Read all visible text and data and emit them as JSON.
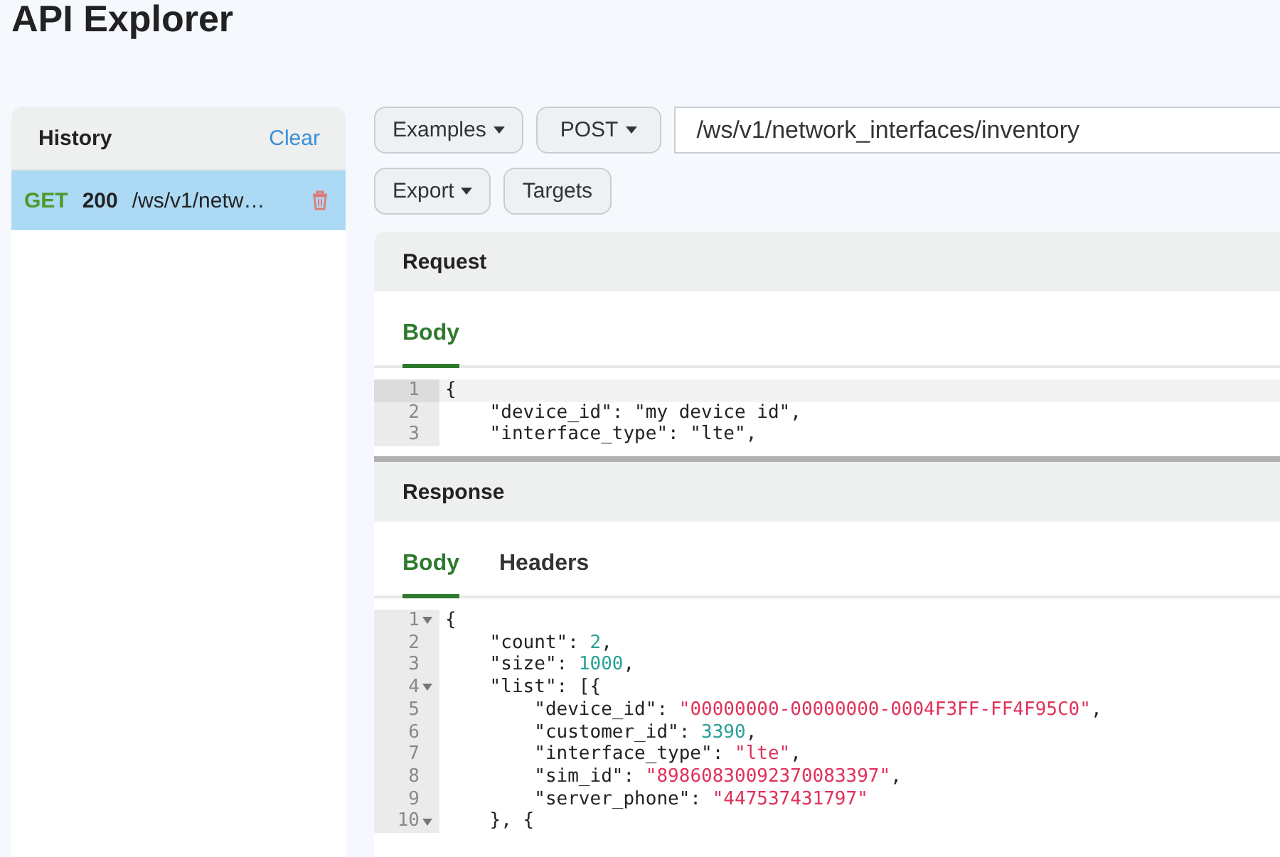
{
  "page_title": "API Explorer",
  "history": {
    "title": "History",
    "clear": "Clear",
    "items": [
      {
        "method": "GET",
        "status": "200",
        "path": "/ws/v1/netw…",
        "selected": true
      }
    ]
  },
  "toolbar": {
    "examples": "Examples",
    "method": "POST",
    "url": "/ws/v1/network_interfaces/inventory",
    "export": "Export",
    "targets": "Targets"
  },
  "request": {
    "title": "Request",
    "tabs": [
      {
        "label": "Body",
        "selected": true
      }
    ],
    "lines": [
      {
        "number": "1",
        "foldable": false,
        "active": true,
        "tokens": [
          {
            "kind": "punct",
            "text": "{"
          }
        ]
      },
      {
        "number": "2",
        "foldable": false,
        "active": false,
        "tokens": [
          {
            "kind": "punct",
            "text": "    \"device_id\": \"my device id\","
          }
        ]
      },
      {
        "number": "3",
        "foldable": false,
        "active": false,
        "tokens": [
          {
            "kind": "punct",
            "text": "    \"interface_type\": \"lte\","
          }
        ]
      }
    ]
  },
  "response": {
    "title": "Response",
    "tabs": [
      {
        "label": "Body",
        "selected": true
      },
      {
        "label": "Headers",
        "selected": false
      }
    ],
    "lines": [
      {
        "number": "1",
        "foldable": true,
        "active": false,
        "tokens": [
          {
            "kind": "punct",
            "text": "{"
          }
        ]
      },
      {
        "number": "2",
        "foldable": false,
        "active": false,
        "tokens": [
          {
            "kind": "punct",
            "text": "    \"count\": "
          },
          {
            "kind": "number",
            "text": "2"
          },
          {
            "kind": "punct",
            "text": ","
          }
        ]
      },
      {
        "number": "3",
        "foldable": false,
        "active": false,
        "tokens": [
          {
            "kind": "punct",
            "text": "    \"size\": "
          },
          {
            "kind": "number",
            "text": "1000"
          },
          {
            "kind": "punct",
            "text": ","
          }
        ]
      },
      {
        "number": "4",
        "foldable": true,
        "active": false,
        "tokens": [
          {
            "kind": "punct",
            "text": "    \"list\": [{"
          }
        ]
      },
      {
        "number": "5",
        "foldable": false,
        "active": false,
        "tokens": [
          {
            "kind": "punct",
            "text": "        \"device_id\": "
          },
          {
            "kind": "string",
            "text": "\"00000000-00000000-0004F3FF-FF4F95C0\""
          },
          {
            "kind": "punct",
            "text": ","
          }
        ]
      },
      {
        "number": "6",
        "foldable": false,
        "active": false,
        "tokens": [
          {
            "kind": "punct",
            "text": "        \"customer_id\": "
          },
          {
            "kind": "number",
            "text": "3390"
          },
          {
            "kind": "punct",
            "text": ","
          }
        ]
      },
      {
        "number": "7",
        "foldable": false,
        "active": false,
        "tokens": [
          {
            "kind": "punct",
            "text": "        \"interface_type\": "
          },
          {
            "kind": "string",
            "text": "\"lte\""
          },
          {
            "kind": "punct",
            "text": ","
          }
        ]
      },
      {
        "number": "8",
        "foldable": false,
        "active": false,
        "tokens": [
          {
            "kind": "punct",
            "text": "        \"sim_id\": "
          },
          {
            "kind": "string",
            "text": "\"89860830092370083397\""
          },
          {
            "kind": "punct",
            "text": ","
          }
        ]
      },
      {
        "number": "9",
        "foldable": false,
        "active": false,
        "tokens": [
          {
            "kind": "punct",
            "text": "        \"server_phone\": "
          },
          {
            "kind": "string",
            "text": "\"447537431797\""
          }
        ]
      },
      {
        "number": "10",
        "foldable": true,
        "active": false,
        "tokens": [
          {
            "kind": "punct",
            "text": "    }, {"
          }
        ]
      }
    ]
  }
}
